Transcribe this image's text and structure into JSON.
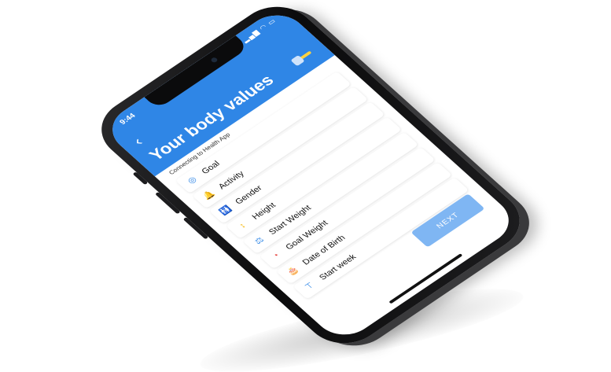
{
  "status_bar": {
    "time": "9:44"
  },
  "header": {
    "back_glyph": "‹",
    "title": "Your body values"
  },
  "subtitle": "Connecting to Health App",
  "items": [
    {
      "label": "Goal",
      "icon": "target-icon",
      "glyph": "◎",
      "color": "#2f86e6"
    },
    {
      "label": "Activity",
      "icon": "bell-icon",
      "glyph": "🔔",
      "color": "#f5b400"
    },
    {
      "label": "Gender",
      "icon": "gender-icon",
      "glyph": "🚻",
      "color": "#e53935"
    },
    {
      "label": "Height",
      "icon": "ruler-icon",
      "glyph": "↕",
      "color": "#f5b400"
    },
    {
      "label": "Start Weight",
      "icon": "scale-icon",
      "glyph": "⚖",
      "color": "#2f86e6"
    },
    {
      "label": "Goal Weight",
      "icon": "gauge-icon",
      "glyph": "◔",
      "color": "#e53935"
    },
    {
      "label": "Date of Birth",
      "icon": "cake-icon",
      "glyph": "🎂",
      "color": "#f5b400"
    },
    {
      "label": "Start week",
      "icon": "calendar-icon",
      "glyph": "⊤",
      "color": "#2f86e6"
    }
  ],
  "next_button": {
    "label": "NEXT"
  },
  "colors": {
    "accent": "#2f86e6",
    "button_disabled": "#7fb6f3"
  }
}
